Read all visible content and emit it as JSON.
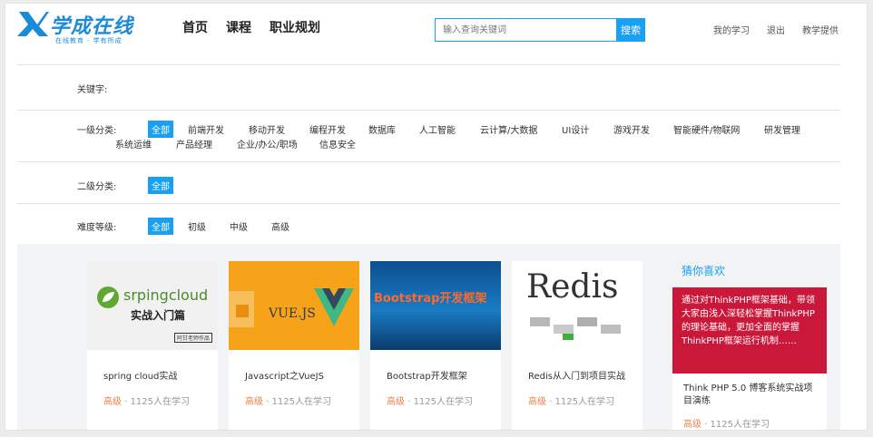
{
  "logo": {
    "text": "学成在线",
    "slogan": "在线教育 · 学有所成"
  },
  "main_nav": [
    "首页",
    "课程",
    "职业规划"
  ],
  "search": {
    "placeholder": "输入查询关键词",
    "button": "搜索"
  },
  "user_nav": [
    "我的学习",
    "退出",
    "教学提供"
  ],
  "filters": {
    "keyword_label": "关键字:",
    "category1": {
      "label": "一级分类:",
      "row1": [
        "全部",
        "前端开发",
        "移动开发",
        "编程开发",
        "数据库",
        "人工智能",
        "云计算/大数据",
        "UI设计",
        "游戏开发",
        "智能硬件/物联网",
        "研发管理"
      ],
      "row2": [
        "系统运维",
        "产品经理",
        "企业/办公/职场",
        "信息安全"
      ]
    },
    "category2": {
      "label": "二级分类:",
      "options": [
        "全部"
      ]
    },
    "difficulty": {
      "label": "难度等级:",
      "options": [
        "全部",
        "初级",
        "中级",
        "高级"
      ]
    }
  },
  "courses": [
    {
      "title": "spring cloud实战",
      "level": "高级",
      "meta": "· 1125人在学习",
      "thumb_text": "srpingcloud",
      "thumb_sub": "实战入门篇",
      "thumb_tag": "阿甘老师作品"
    },
    {
      "title": "Javascript之VueJS",
      "level": "高级",
      "meta": "· 1125人在学习",
      "thumb_text": "VUE.JS"
    },
    {
      "title": "Bootstrap开发框架",
      "level": "高级",
      "meta": "· 1125人在学习",
      "thumb_text": "Bootstrap开发框架"
    },
    {
      "title": "Redis从入门到项目实战",
      "level": "高级",
      "meta": "· 1125人在学习",
      "thumb_text": "Redis"
    }
  ],
  "guess": {
    "title": "猜你喜欢",
    "banner": "通过对ThinkPHP框架基础，带领大家由浅入深轻松掌握ThinkPHP的理论基础，更加全面的掌握ThinkPHP框架运行机制……",
    "course_title": "Think PHP 5.0 博客系统实战项目演练",
    "level": "高级",
    "meta": "· 1125人在学习"
  },
  "colors": {
    "accent": "#19a0f0",
    "level": "#f0804a",
    "banner": "#c9183a"
  }
}
